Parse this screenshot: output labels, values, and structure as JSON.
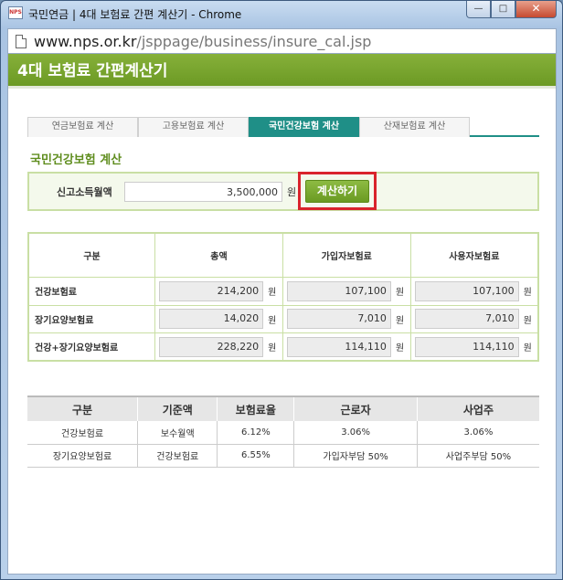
{
  "window": {
    "title": "국민연금 | 4대 보험료 간편 계산기 - Chrome",
    "logo_text": "NPS",
    "minimize": "—",
    "maximize": "□",
    "close": "✕"
  },
  "address": {
    "host": "www.nps.or.kr",
    "path": "/jsppage/business/insure_cal.jsp"
  },
  "page": {
    "header": "4대 보험료 간편계산기",
    "tabs": [
      {
        "label": "연금보험료 계산"
      },
      {
        "label": "고용보험료 계산"
      },
      {
        "label": "국민건강보험 계산"
      },
      {
        "label": "산재보험료 계산"
      }
    ],
    "section_title": "국민건강보험 계산",
    "income": {
      "label": "신고소득월액",
      "value": "3,500,000",
      "unit": "원",
      "calc_button": "계산하기"
    },
    "result": {
      "headers": [
        "구분",
        "총액",
        "가입자보험료",
        "사용자보험료"
      ],
      "unit": "원",
      "rows": [
        {
          "label": "건강보험료",
          "total": "214,200",
          "employee": "107,100",
          "employer": "107,100"
        },
        {
          "label": "장기요양보험료",
          "total": "14,020",
          "employee": "7,010",
          "employer": "7,010"
        },
        {
          "label": "건강+장기요양보험료",
          "total": "228,220",
          "employee": "114,110",
          "employer": "114,110"
        }
      ]
    },
    "rates": {
      "headers": [
        "구분",
        "기준액",
        "보험료율",
        "근로자",
        "사업주"
      ],
      "rows": [
        [
          "건강보험료",
          "보수월액",
          "6.12%",
          "3.06%",
          "3.06%"
        ],
        [
          "장기요양보험료",
          "건강보험료",
          "6.55%",
          "가입자부담 50%",
          "사업주부담 50%"
        ]
      ]
    }
  }
}
